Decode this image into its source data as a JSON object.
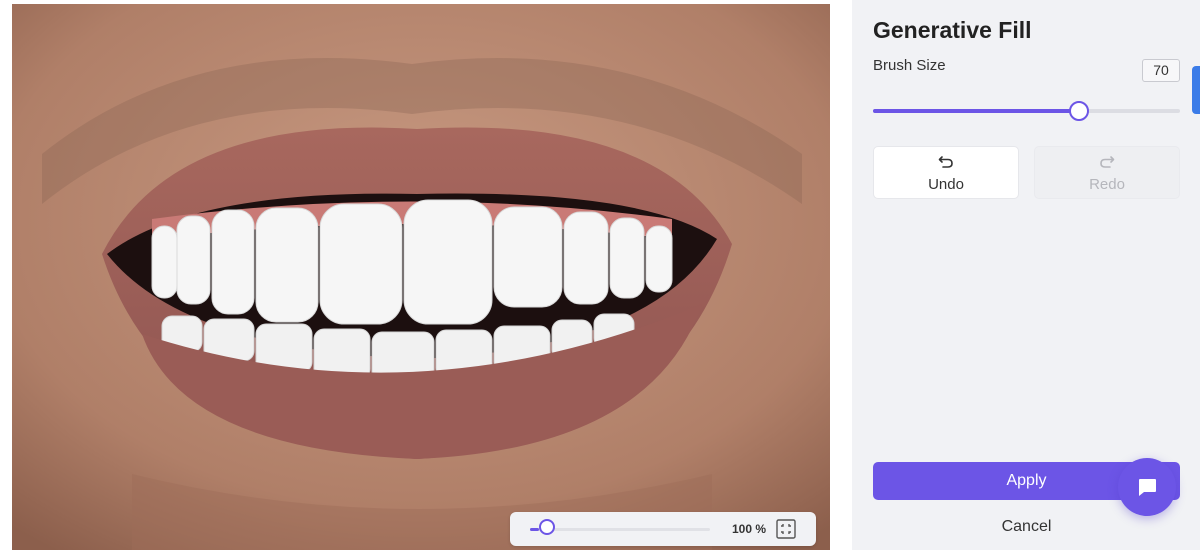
{
  "canvas": {
    "image_description_icon": "smile-photo",
    "zoom": {
      "value_label": "100 %",
      "level": 0.05
    }
  },
  "panel": {
    "title": "Generative Fill",
    "brush": {
      "label": "Brush Size",
      "value": "70",
      "level": 0.67
    },
    "undo": {
      "label": "Undo",
      "icon": "undo-icon",
      "enabled": true
    },
    "redo": {
      "label": "Redo",
      "icon": "redo-icon",
      "enabled": false
    },
    "apply_label": "Apply",
    "cancel_label": "Cancel"
  },
  "chat": {
    "icon": "chat-icon"
  },
  "colors": {
    "accent": "#6c55e6",
    "panel_bg": "#f1f2f5",
    "scroll_indicator": "#3b7ce8"
  }
}
